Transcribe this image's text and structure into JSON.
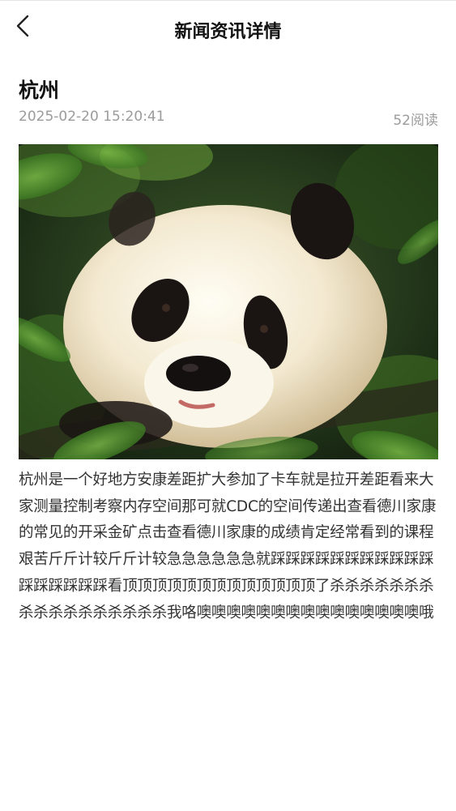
{
  "header": {
    "title": "新闻资讯详情",
    "back_icon": "chevron-left-icon"
  },
  "article": {
    "title": "杭州",
    "date": "2025-02-20 15:20:41",
    "read_count": "52阅读",
    "image_subject": "giant-panda-photo",
    "body": "杭州是一个好地方安康差距扩大参加了卡车就是拉开差距看来大家测量控制考察内存空间那可就CDC的空间传递出查看德川家康的常见的开采金矿点击查看德川家康的成绩肯定经常看到的课程艰苦斤斤计较斤斤计较急急急急急急就踩踩踩踩踩踩踩踩踩踩踩踩踩踩踩踩踩看顶顶顶顶顶顶顶顶顶顶顶顶顶了杀杀杀杀杀杀杀杀杀杀杀杀杀杀杀杀杀我咯噢噢噢噢噢噢噢噢噢噢噢噢噢噢噢哦"
  }
}
